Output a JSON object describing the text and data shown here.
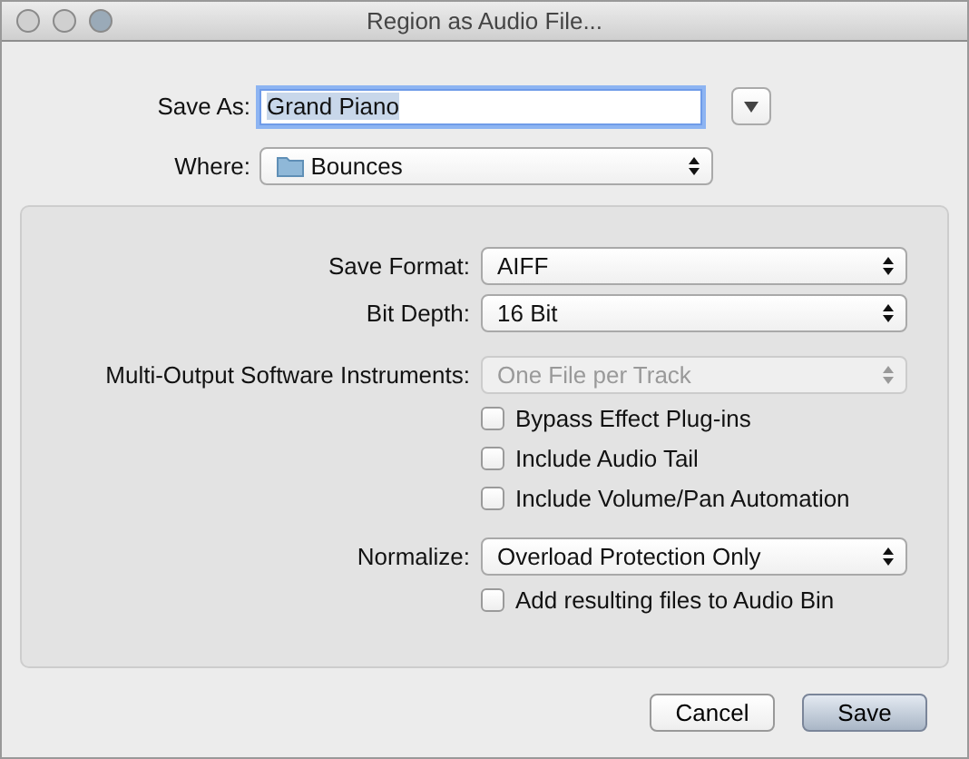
{
  "window": {
    "title": "Region as Audio File..."
  },
  "save_as": {
    "label": "Save As:",
    "value": "Grand Piano",
    "text_selected": true
  },
  "where": {
    "label": "Where:",
    "value": "Bounces"
  },
  "groups": [
    [
      {
        "kind": "popup",
        "label": "Save Format:",
        "value": "AIFF",
        "disabled": false
      },
      {
        "kind": "popup",
        "label": "Bit Depth:",
        "value": "16 Bit",
        "disabled": false
      }
    ],
    [
      {
        "kind": "popup",
        "label": "Multi-Output Software Instruments:",
        "value": "One File per Track",
        "disabled": true
      },
      {
        "kind": "checkbox",
        "label": "Bypass Effect Plug-ins",
        "checked": false
      },
      {
        "kind": "checkbox",
        "label": "Include Audio Tail",
        "checked": false
      },
      {
        "kind": "checkbox",
        "label": "Include Volume/Pan Automation",
        "checked": false
      }
    ],
    [
      {
        "kind": "popup",
        "label": "Normalize:",
        "value": "Overload Protection Only",
        "disabled": false
      },
      {
        "kind": "checkbox",
        "label": "Add resulting files to Audio Bin",
        "checked": false
      }
    ]
  ],
  "buttons": [
    {
      "label": "Cancel",
      "default": false
    },
    {
      "label": "Save",
      "default": true
    }
  ]
}
